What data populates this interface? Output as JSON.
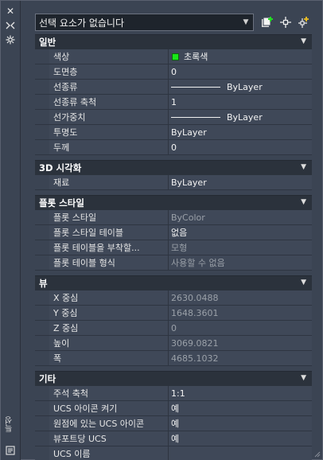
{
  "header": {
    "selection": "선택 요소가 없습니다"
  },
  "strip": {
    "vertical_label": "특성"
  },
  "sections": {
    "general": {
      "title": "일반",
      "rows": [
        {
          "name": "색상",
          "value": "초록색"
        },
        {
          "name": "도면층",
          "value": "0"
        },
        {
          "name": "선종류",
          "value": "ByLayer"
        },
        {
          "name": "선종류 축척",
          "value": "1"
        },
        {
          "name": "선가중치",
          "value": "ByLayer"
        },
        {
          "name": "투명도",
          "value": "ByLayer"
        },
        {
          "name": "두께",
          "value": "0"
        }
      ]
    },
    "visual3d": {
      "title": "3D 시각화",
      "rows": [
        {
          "name": "재료",
          "value": "ByLayer"
        }
      ]
    },
    "plotstyle": {
      "title": "플롯 스타일",
      "rows": [
        {
          "name": "플롯 스타일",
          "value": "ByColor"
        },
        {
          "name": "플롯 스타일 테이블",
          "value": "없음"
        },
        {
          "name": "플롯 테이블을 부착할...",
          "value": "모형"
        },
        {
          "name": "플롯 테이블 형식",
          "value": "사용할 수 없음"
        }
      ]
    },
    "view": {
      "title": "뷰",
      "rows": [
        {
          "name": "X 중심",
          "value": "2630.0488"
        },
        {
          "name": "Y 중심",
          "value": "1648.3601"
        },
        {
          "name": "Z 중심",
          "value": "0"
        },
        {
          "name": "높이",
          "value": "3069.0821"
        },
        {
          "name": "폭",
          "value": "4685.1032"
        }
      ]
    },
    "misc": {
      "title": "기타",
      "rows": [
        {
          "name": "주석 축척",
          "value": "1:1"
        },
        {
          "name": "UCS 아이콘 켜기",
          "value": "예"
        },
        {
          "name": "원점에 있는 UCS 아이콘",
          "value": "예"
        },
        {
          "name": "뷰포트당 UCS",
          "value": "예"
        },
        {
          "name": "UCS 이름",
          "value": ""
        }
      ]
    }
  },
  "colors": {
    "swatch_green": "#19e619",
    "panel_bg": "#3b4453",
    "category_bg": "#2b323c"
  },
  "icons": [
    "close-icon",
    "auto-hide-icon",
    "settings-icon",
    "quick-select-icon",
    "select-objects-icon",
    "toggle-pickadd-icon",
    "properties-icon"
  ]
}
